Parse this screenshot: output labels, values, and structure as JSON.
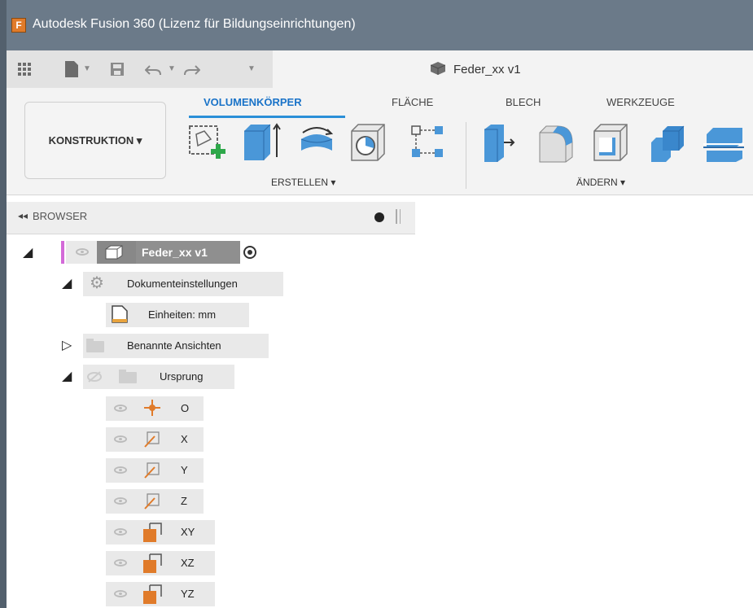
{
  "window": {
    "title": "Autodesk Fusion 360 (Lizenz für Bildungseinrichtungen)",
    "app_icon_letter": "F"
  },
  "quickbar": {
    "document_name": "Feder_xx v1"
  },
  "ribbon": {
    "workspace": "KONSTRUKTION ▾",
    "tabs": [
      "VOLUMENKÖRPER",
      "FLÄCHE",
      "BLECH",
      "WERKZEUGE"
    ],
    "groups": {
      "create": "ERSTELLEN ▾",
      "modify": "ÄNDERN ▾"
    }
  },
  "browser": {
    "title": "BROWSER",
    "root": {
      "label": "Feder_xx v1"
    },
    "doc_settings": {
      "label": "Dokumenteinstellungen",
      "units": "Einheiten: mm"
    },
    "named_views": {
      "label": "Benannte Ansichten"
    },
    "origin": {
      "label": "Ursprung",
      "items": [
        "O",
        "X",
        "Y",
        "Z",
        "XY",
        "XZ",
        "YZ"
      ]
    }
  },
  "colors": {
    "accent": "#2a8fd8",
    "titlebar": "#6b7a89",
    "origin": "#e07b2a"
  }
}
